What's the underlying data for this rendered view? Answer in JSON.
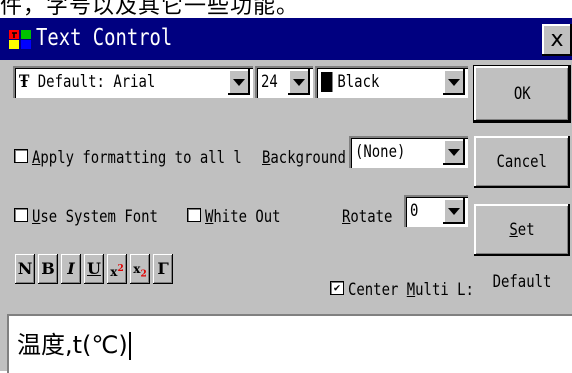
{
  "background_text": "件，字号以及其它一些功能。",
  "window": {
    "title": "Text Control",
    "close_label": "x"
  },
  "font": {
    "value": "Default: Arial",
    "size": "24",
    "color_name": "Black",
    "color_hex": "#000000"
  },
  "apply_formatting": {
    "checked": false,
    "label_accel": "A",
    "label_rest": "pply formatting to all l"
  },
  "background": {
    "label_accel": "B",
    "label_rest": "ackground",
    "value": "(None)"
  },
  "use_system_font": {
    "checked": false,
    "label_accel": "U",
    "label_rest": "se System Font"
  },
  "white_out": {
    "checked": false,
    "label_accel": "W",
    "label_rest": "hite Out"
  },
  "rotate": {
    "label_accel": "R",
    "label_rest": "otate",
    "value": "0"
  },
  "format_buttons": [
    "N",
    "B",
    "I",
    "U",
    "x2",
    "x2",
    "Γ"
  ],
  "center_multi": {
    "checked": true,
    "label_pre": "Center ",
    "label_accel": "M",
    "label_rest": "ulti L:"
  },
  "buttons": {
    "ok": "OK",
    "cancel": "Cancel",
    "set_default_accel": "S",
    "set_default_rest": "et Default"
  },
  "text_value": "温度,t(℃)"
}
